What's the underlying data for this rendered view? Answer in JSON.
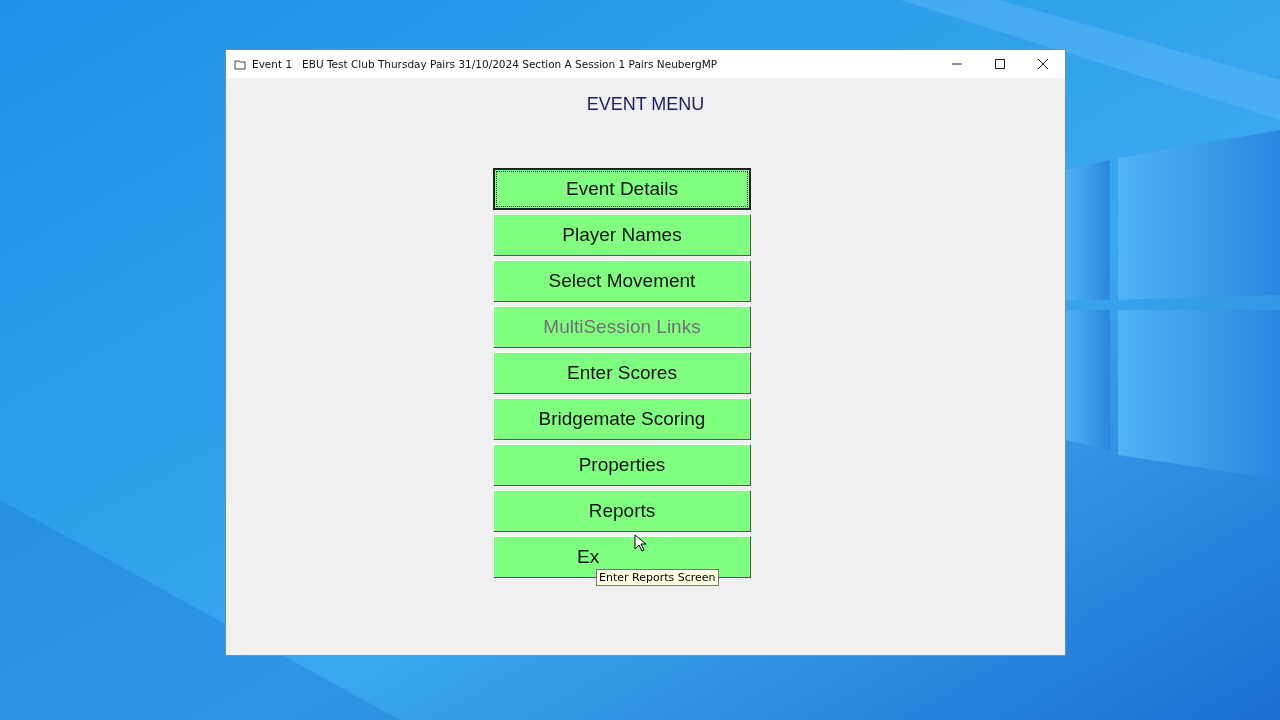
{
  "window": {
    "title": "Event 1   EBU Test Club Thursday Pairs 31/10/2024 Section A Session 1 Pairs NeubergMP"
  },
  "heading": "EVENT MENU",
  "buttons": [
    {
      "label": "Event Details",
      "focused": true,
      "disabled": false
    },
    {
      "label": "Player Names",
      "focused": false,
      "disabled": false
    },
    {
      "label": "Select Movement",
      "focused": false,
      "disabled": false
    },
    {
      "label": "MultiSession Links",
      "focused": false,
      "disabled": true
    },
    {
      "label": "Enter Scores",
      "focused": false,
      "disabled": false
    },
    {
      "label": "Bridgemate Scoring",
      "focused": false,
      "disabled": false
    },
    {
      "label": "Properties",
      "focused": false,
      "disabled": false
    },
    {
      "label": "Reports",
      "focused": false,
      "disabled": false
    },
    {
      "label": "Ex",
      "focused": false,
      "disabled": false,
      "kind": "covered"
    }
  ],
  "tooltip": "Enter Reports Screen"
}
